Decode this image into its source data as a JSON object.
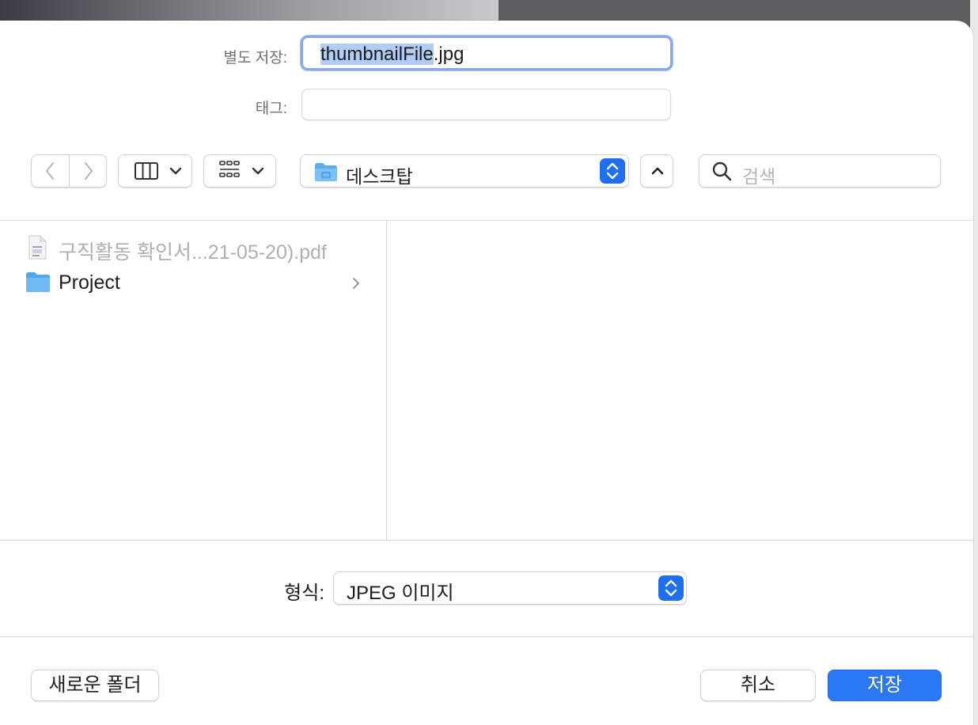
{
  "dialog": {
    "save_as_label": "별도 저장:",
    "filename_selected": "thumbnailFile",
    "filename_ext": ".jpg",
    "tags_label": "태그:",
    "tags_value": ""
  },
  "toolbar": {
    "location": "데스크탑",
    "search_placeholder": "검색"
  },
  "browser": {
    "items": [
      {
        "name": "구직활동 확인서...21-05-20).pdf",
        "type": "pdf",
        "enabled": false
      },
      {
        "name": "Project",
        "type": "folder",
        "enabled": true
      }
    ]
  },
  "format": {
    "label": "형식:",
    "value": "JPEG 이미지"
  },
  "buttons": {
    "new_folder": "새로운 폴더",
    "cancel": "취소",
    "save": "저장"
  },
  "colors": {
    "accent": "#2a78f3",
    "folder": "#5aaef0",
    "selection": "#b2cdf5"
  }
}
